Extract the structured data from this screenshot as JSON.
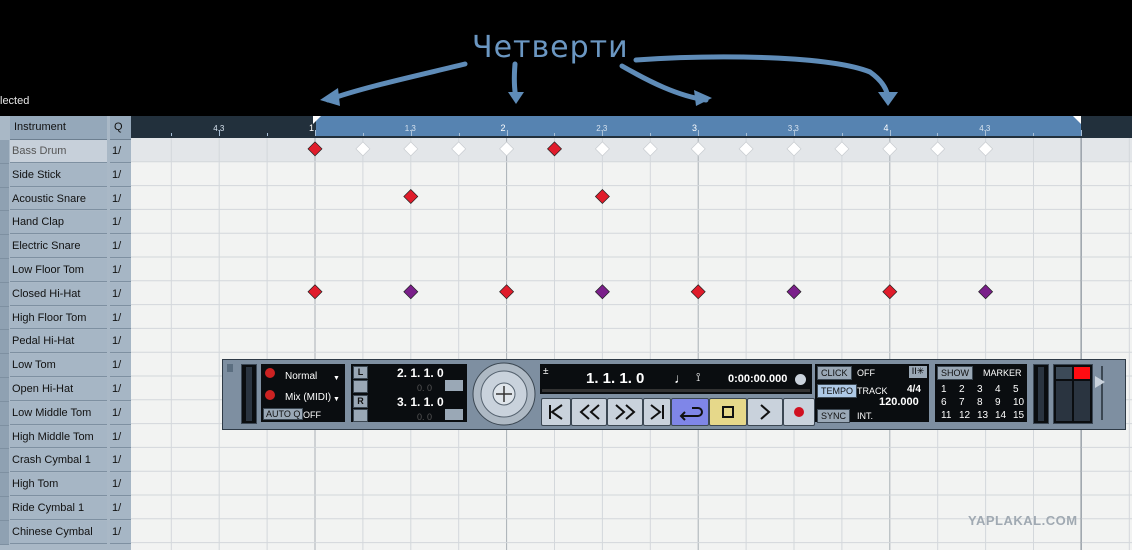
{
  "annotation": {
    "label": "Четверти"
  },
  "status": {
    "selected_text": "lected"
  },
  "list": {
    "headers": {
      "instrument": "Instrument",
      "quantize": "Q"
    },
    "instruments": [
      {
        "name": "Bass Drum",
        "q": "1/"
      },
      {
        "name": "Side Stick",
        "q": "1/"
      },
      {
        "name": "Acoustic Snare",
        "q": "1/"
      },
      {
        "name": "Hand Clap",
        "q": "1/"
      },
      {
        "name": "Electric Snare",
        "q": "1/"
      },
      {
        "name": "Low Floor Tom",
        "q": "1/"
      },
      {
        "name": "Closed Hi-Hat",
        "q": "1/"
      },
      {
        "name": "High Floor Tom",
        "q": "1/"
      },
      {
        "name": "Pedal Hi-Hat",
        "q": "1/"
      },
      {
        "name": "Low Tom",
        "q": "1/"
      },
      {
        "name": "Open Hi-Hat",
        "q": "1/"
      },
      {
        "name": "Low Middle Tom",
        "q": "1/"
      },
      {
        "name": "High Middle Tom",
        "q": "1/"
      },
      {
        "name": "Crash Cymbal 1",
        "q": "1/"
      },
      {
        "name": "High Tom",
        "q": "1/"
      },
      {
        "name": "Ride Cymbal 1",
        "q": "1/"
      },
      {
        "name": "Chinese Cymbal",
        "q": "1/"
      }
    ]
  },
  "ruler": {
    "labels": [
      "4.3",
      "1",
      "1.3",
      "2",
      "2.3",
      "3",
      "3.3",
      "4",
      "4.3"
    ]
  },
  "pattern": {
    "beats_per_row_step": 0.5,
    "bass_drum": [
      1,
      3.5
    ],
    "ghost_row_empty": [
      1.5,
      2,
      2.5,
      3,
      4,
      4.5,
      5,
      5.5,
      6,
      6.5,
      7,
      7.5,
      8
    ],
    "acoustic_snare": [
      3,
      7
    ],
    "closed_hihat_accent": [
      1,
      3,
      5,
      7
    ],
    "closed_hihat_soft": [
      2,
      4,
      6,
      8
    ],
    "colors": {
      "accent": "#e01c2b",
      "soft": "#7a1f8a",
      "empty": "#ffffff"
    }
  },
  "transport": {
    "mode": "Normal",
    "mix_mode": "Mix (MIDI)",
    "auto_q": "AUTO Q",
    "auto_q_state": "OFF",
    "left_locator": "2. 1. 1.   0",
    "left_locator_sub": "0.   0",
    "right_locator": "3. 1. 1.   0",
    "right_locator_sub": "0.   0",
    "position_bars": "1. 1. 1.   0",
    "position_time": "0:00:00.000",
    "click_label": "CLICK",
    "click_state": "OFF",
    "tempo_label": "TEMPO",
    "tempo_mode": "TRACK",
    "signature": "4/4",
    "tempo_value": "120.000",
    "sync_label": "SYNC",
    "sync_state": "INT.",
    "show_label": "SHOW",
    "marker_label": "MARKER",
    "markers": [
      "1",
      "2",
      "3",
      "4",
      "5",
      "6",
      "7",
      "8",
      "9",
      "10",
      "11",
      "12",
      "13",
      "14",
      "15"
    ],
    "locator_letters": {
      "left": "L",
      "right": "R"
    }
  },
  "watermark": {
    "text": "YAPLAKAL.COM"
  }
}
